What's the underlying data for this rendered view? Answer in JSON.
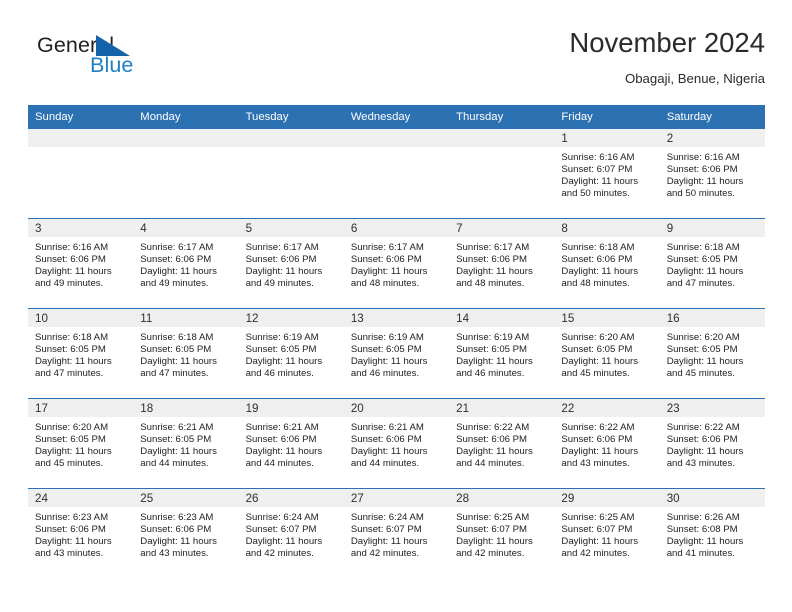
{
  "branding": {
    "name_part1": "General",
    "name_part2": "Blue",
    "triangle_color": "#1463a8",
    "blue_text_color": "#1e7fc4"
  },
  "header": {
    "title": "November 2024",
    "subtitle": "Obagaji, Benue, Nigeria",
    "accent_color": "#2c71b2",
    "daynum_band_color": "#efefef"
  },
  "calendar": {
    "weekday_headers": [
      "Sunday",
      "Monday",
      "Tuesday",
      "Wednesday",
      "Thursday",
      "Friday",
      "Saturday"
    ],
    "weeks": [
      [
        {
          "day": "",
          "empty": true
        },
        {
          "day": "",
          "empty": true
        },
        {
          "day": "",
          "empty": true
        },
        {
          "day": "",
          "empty": true
        },
        {
          "day": "",
          "empty": true
        },
        {
          "day": "1",
          "sunrise": "Sunrise: 6:16 AM",
          "sunset": "Sunset: 6:07 PM",
          "daylight_line1": "Daylight: 11 hours",
          "daylight_line2": "and 50 minutes."
        },
        {
          "day": "2",
          "sunrise": "Sunrise: 6:16 AM",
          "sunset": "Sunset: 6:06 PM",
          "daylight_line1": "Daylight: 11 hours",
          "daylight_line2": "and 50 minutes."
        }
      ],
      [
        {
          "day": "3",
          "sunrise": "Sunrise: 6:16 AM",
          "sunset": "Sunset: 6:06 PM",
          "daylight_line1": "Daylight: 11 hours",
          "daylight_line2": "and 49 minutes."
        },
        {
          "day": "4",
          "sunrise": "Sunrise: 6:17 AM",
          "sunset": "Sunset: 6:06 PM",
          "daylight_line1": "Daylight: 11 hours",
          "daylight_line2": "and 49 minutes."
        },
        {
          "day": "5",
          "sunrise": "Sunrise: 6:17 AM",
          "sunset": "Sunset: 6:06 PM",
          "daylight_line1": "Daylight: 11 hours",
          "daylight_line2": "and 49 minutes."
        },
        {
          "day": "6",
          "sunrise": "Sunrise: 6:17 AM",
          "sunset": "Sunset: 6:06 PM",
          "daylight_line1": "Daylight: 11 hours",
          "daylight_line2": "and 48 minutes."
        },
        {
          "day": "7",
          "sunrise": "Sunrise: 6:17 AM",
          "sunset": "Sunset: 6:06 PM",
          "daylight_line1": "Daylight: 11 hours",
          "daylight_line2": "and 48 minutes."
        },
        {
          "day": "8",
          "sunrise": "Sunrise: 6:18 AM",
          "sunset": "Sunset: 6:06 PM",
          "daylight_line1": "Daylight: 11 hours",
          "daylight_line2": "and 48 minutes."
        },
        {
          "day": "9",
          "sunrise": "Sunrise: 6:18 AM",
          "sunset": "Sunset: 6:05 PM",
          "daylight_line1": "Daylight: 11 hours",
          "daylight_line2": "and 47 minutes."
        }
      ],
      [
        {
          "day": "10",
          "sunrise": "Sunrise: 6:18 AM",
          "sunset": "Sunset: 6:05 PM",
          "daylight_line1": "Daylight: 11 hours",
          "daylight_line2": "and 47 minutes."
        },
        {
          "day": "11",
          "sunrise": "Sunrise: 6:18 AM",
          "sunset": "Sunset: 6:05 PM",
          "daylight_line1": "Daylight: 11 hours",
          "daylight_line2": "and 47 minutes."
        },
        {
          "day": "12",
          "sunrise": "Sunrise: 6:19 AM",
          "sunset": "Sunset: 6:05 PM",
          "daylight_line1": "Daylight: 11 hours",
          "daylight_line2": "and 46 minutes."
        },
        {
          "day": "13",
          "sunrise": "Sunrise: 6:19 AM",
          "sunset": "Sunset: 6:05 PM",
          "daylight_line1": "Daylight: 11 hours",
          "daylight_line2": "and 46 minutes."
        },
        {
          "day": "14",
          "sunrise": "Sunrise: 6:19 AM",
          "sunset": "Sunset: 6:05 PM",
          "daylight_line1": "Daylight: 11 hours",
          "daylight_line2": "and 46 minutes."
        },
        {
          "day": "15",
          "sunrise": "Sunrise: 6:20 AM",
          "sunset": "Sunset: 6:05 PM",
          "daylight_line1": "Daylight: 11 hours",
          "daylight_line2": "and 45 minutes."
        },
        {
          "day": "16",
          "sunrise": "Sunrise: 6:20 AM",
          "sunset": "Sunset: 6:05 PM",
          "daylight_line1": "Daylight: 11 hours",
          "daylight_line2": "and 45 minutes."
        }
      ],
      [
        {
          "day": "17",
          "sunrise": "Sunrise: 6:20 AM",
          "sunset": "Sunset: 6:05 PM",
          "daylight_line1": "Daylight: 11 hours",
          "daylight_line2": "and 45 minutes."
        },
        {
          "day": "18",
          "sunrise": "Sunrise: 6:21 AM",
          "sunset": "Sunset: 6:05 PM",
          "daylight_line1": "Daylight: 11 hours",
          "daylight_line2": "and 44 minutes."
        },
        {
          "day": "19",
          "sunrise": "Sunrise: 6:21 AM",
          "sunset": "Sunset: 6:06 PM",
          "daylight_line1": "Daylight: 11 hours",
          "daylight_line2": "and 44 minutes."
        },
        {
          "day": "20",
          "sunrise": "Sunrise: 6:21 AM",
          "sunset": "Sunset: 6:06 PM",
          "daylight_line1": "Daylight: 11 hours",
          "daylight_line2": "and 44 minutes."
        },
        {
          "day": "21",
          "sunrise": "Sunrise: 6:22 AM",
          "sunset": "Sunset: 6:06 PM",
          "daylight_line1": "Daylight: 11 hours",
          "daylight_line2": "and 44 minutes."
        },
        {
          "day": "22",
          "sunrise": "Sunrise: 6:22 AM",
          "sunset": "Sunset: 6:06 PM",
          "daylight_line1": "Daylight: 11 hours",
          "daylight_line2": "and 43 minutes."
        },
        {
          "day": "23",
          "sunrise": "Sunrise: 6:22 AM",
          "sunset": "Sunset: 6:06 PM",
          "daylight_line1": "Daylight: 11 hours",
          "daylight_line2": "and 43 minutes."
        }
      ],
      [
        {
          "day": "24",
          "sunrise": "Sunrise: 6:23 AM",
          "sunset": "Sunset: 6:06 PM",
          "daylight_line1": "Daylight: 11 hours",
          "daylight_line2": "and 43 minutes."
        },
        {
          "day": "25",
          "sunrise": "Sunrise: 6:23 AM",
          "sunset": "Sunset: 6:06 PM",
          "daylight_line1": "Daylight: 11 hours",
          "daylight_line2": "and 43 minutes."
        },
        {
          "day": "26",
          "sunrise": "Sunrise: 6:24 AM",
          "sunset": "Sunset: 6:07 PM",
          "daylight_line1": "Daylight: 11 hours",
          "daylight_line2": "and 42 minutes."
        },
        {
          "day": "27",
          "sunrise": "Sunrise: 6:24 AM",
          "sunset": "Sunset: 6:07 PM",
          "daylight_line1": "Daylight: 11 hours",
          "daylight_line2": "and 42 minutes."
        },
        {
          "day": "28",
          "sunrise": "Sunrise: 6:25 AM",
          "sunset": "Sunset: 6:07 PM",
          "daylight_line1": "Daylight: 11 hours",
          "daylight_line2": "and 42 minutes."
        },
        {
          "day": "29",
          "sunrise": "Sunrise: 6:25 AM",
          "sunset": "Sunset: 6:07 PM",
          "daylight_line1": "Daylight: 11 hours",
          "daylight_line2": "and 42 minutes."
        },
        {
          "day": "30",
          "sunrise": "Sunrise: 6:26 AM",
          "sunset": "Sunset: 6:08 PM",
          "daylight_line1": "Daylight: 11 hours",
          "daylight_line2": "and 41 minutes."
        }
      ]
    ]
  }
}
